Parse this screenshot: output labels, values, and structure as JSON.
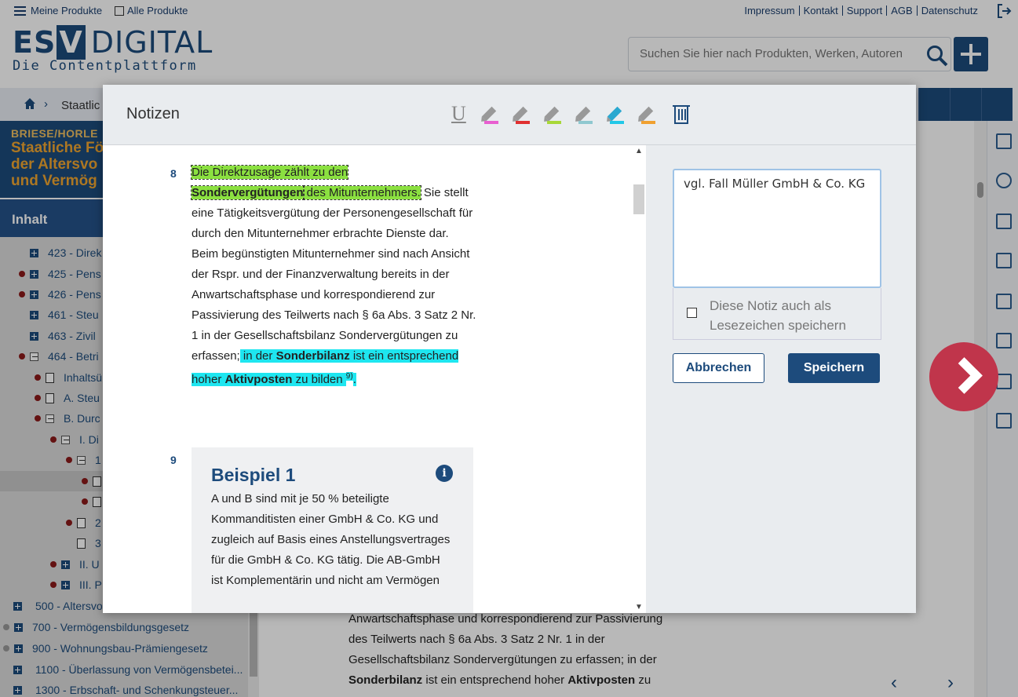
{
  "topbar": {
    "menu_label": "Meine Produkte",
    "all_products_label": "Alle Produkte",
    "links": [
      "Impressum",
      "Kontakt",
      "Support",
      "AGB",
      "Datenschutz"
    ]
  },
  "logo": {
    "part1": "ES",
    "part2": "V",
    "part3": "DIGITAL",
    "tagline": "Die Contentplattform"
  },
  "search": {
    "placeholder": "Suchen Sie hier nach Produkten, Werken, Autoren"
  },
  "breadcrumb": {
    "current": "Staatlic"
  },
  "banner": {
    "line1": "BRIESE/HORLE",
    "line2": "Staatliche Fö",
    "line3": "der Altersvo",
    "line4": "und Vermög"
  },
  "sidebar": {
    "heading": "Inhalt",
    "items": [
      {
        "label": "423 - Direk"
      },
      {
        "label": "425 - Pens"
      },
      {
        "label": "426 - Pens"
      },
      {
        "label": "461 - Steu"
      },
      {
        "label": "463 - Zivil"
      },
      {
        "label": "464 - Betri"
      },
      {
        "label": "Inhaltsü"
      },
      {
        "label": "A. Steu"
      },
      {
        "label": "B. Durc"
      },
      {
        "label": "I. Di"
      },
      {
        "label": "1"
      },
      {
        "label": ""
      },
      {
        "label": ""
      },
      {
        "label": "2"
      },
      {
        "label": "3"
      },
      {
        "label": "II. U"
      },
      {
        "label": "III. P"
      },
      {
        "label": "500 - Altersvo"
      },
      {
        "label": "700 - Vermögensbildungsgesetz"
      },
      {
        "label": "900 - Wohnungsbau-Prämiengesetz"
      },
      {
        "label": "1100 - Überlassung von Vermögensbetei..."
      },
      {
        "label": "1300 - Erbschaft- und Schenkungsteuer..."
      }
    ]
  },
  "background_text": {
    "line1": "Anwartschaftsphase und korrespondierend zur Passivierung",
    "line2": "des Teilwerts nach § 6a Abs. 3 Satz 2 Nr. 1 in der",
    "line3": "Gesellschaftsbilanz Sondervergütungen zu erfassen; in der",
    "line4a": "Sonderbilanz",
    "line4b": " ist ein entsprechend hoher ",
    "line4c": "Aktivposten",
    "line4d": " zu"
  },
  "modal": {
    "title": "Notizen",
    "tools": {
      "underline": "U",
      "highlighter_colors": [
        "#e85fd0",
        "#e03030",
        "#a8d838",
        "#8fc8d0",
        "#22c8e8",
        "#f0a030"
      ]
    },
    "para8": {
      "number": "8",
      "hl1": "Die Direktzusage zählt zu den",
      "hl2_bold": "Sondervergütungen",
      "hl3": " des Mitunternehmers.",
      "rest": " Sie stellt eine Tätigkeitsvergütung der Personengesellschaft für durch den Mitunternehmer erbrachte Dienste dar. Beim begünstigten Mitunternehmer sind nach Ansicht der Rspr. und der Finanzverwaltung bereits in der Anwartschaftsphase und korrespondierend zur Passivierung des Teilwerts nach § 6a Abs. 3 Satz 2 Nr. 1 in der Gesellschaftsbilanz Sondervergütungen zu erfassen;",
      "cy1": " in der ",
      "cy2_bold": "Sonderbilanz",
      "cy3": " ist ein entsprechend hoher ",
      "cy4_bold": "Aktivposten",
      "cy5": " zu bilden ",
      "footnote": "9)",
      "end": "."
    },
    "para9": {
      "number": "9",
      "heading": "Beispiel 1",
      "text": "A und B sind mit je 50 % beteiligte Kommanditisten einer GmbH & Co. KG und zugleich auf Basis eines Anstellungsvertrages für die GmbH & Co. KG tätig. Die AB-GmbH ist Komplementärin und nicht am Vermögen"
    },
    "note": {
      "value": "vgl. Fall Müller GmbH & Co. KG",
      "bookmark_label": "Diese Notiz auch als Lesezeichen speichern",
      "cancel_label": "Abbrechen",
      "save_label": "Speichern"
    }
  }
}
